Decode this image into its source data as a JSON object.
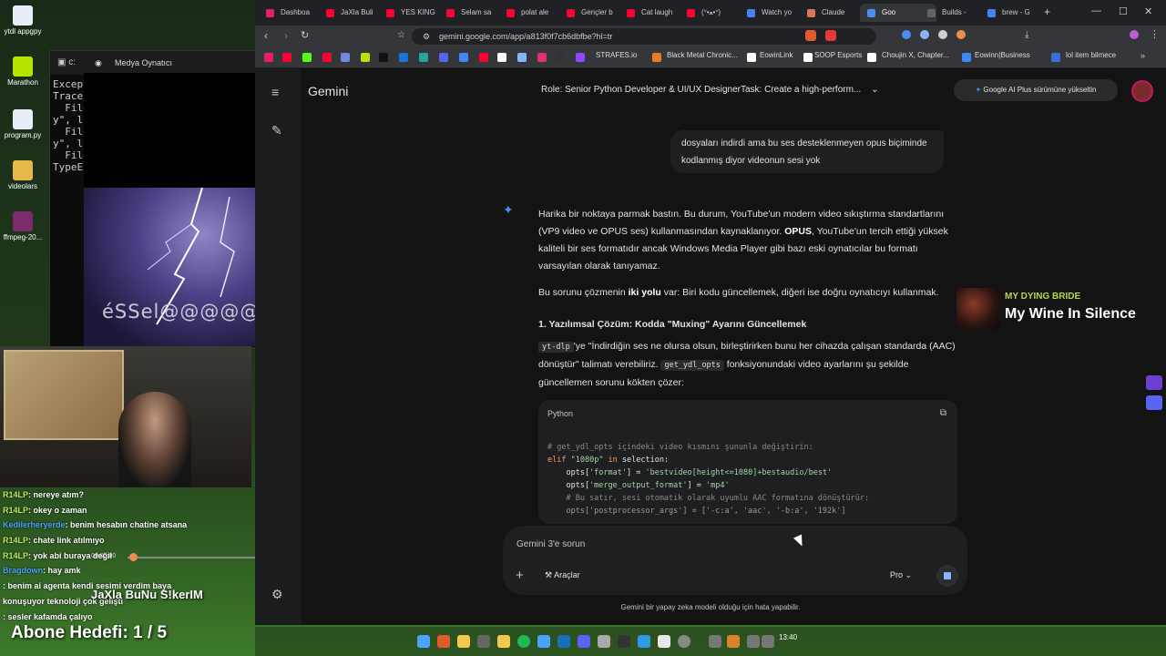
{
  "desktop": {
    "icons": [
      {
        "label": "ytdl appgpy"
      },
      {
        "label": "Marathon"
      },
      {
        "label": "program.py"
      },
      {
        "label": "videolars"
      },
      {
        "label": "ffmpeg-20..."
      }
    ]
  },
  "terminal": {
    "lines": [
      "Except",
      "Tracel",
      "  File",
      "y\", l",
      "",
      "  File",
      "y\", l",
      "",
      "  File",
      "",
      "TypeE"
    ]
  },
  "media_player": {
    "title": "Medya Oynatıcı",
    "caption": "éSSel@@@@@",
    "time": "00:00:00"
  },
  "stream": {
    "name": "JaXla BuNu S!kerIM",
    "abone": "Abone Hedefi:  1 / 5",
    "chat": [
      {
        "nick": "R14LP",
        "text": ": nereye atım?"
      },
      {
        "nick": "R14LP",
        "text": ": okey o zaman"
      },
      {
        "nick": "Kedilerheryerde",
        "text": ": benim hesabın chatine atsana"
      },
      {
        "nick": "R14LP",
        "text": ": chate link atılmıyo"
      },
      {
        "nick": "R14LP",
        "text": ": yok abi buraya değil"
      },
      {
        "nick": "Bragdown",
        "text": ": hay amk"
      },
      {
        "nick": "",
        "text": ": benim ai agenta kendi sesimi verdim baya"
      },
      {
        "nick": "",
        "text": "konuşuyor teknoloji çok gelişti"
      },
      {
        "nick": "",
        "text": ": sesler kafamda çalıyo"
      }
    ]
  },
  "browser": {
    "tabs": [
      "Dashboa",
      "JaXla Buli",
      "YES KING",
      "Selam sa",
      "polat ale",
      "Gençler b",
      "Cat laugh",
      "(ᐡ•ﻌ•ᐡ)",
      "Watch yo",
      "Claude",
      "Goo",
      "Builds -",
      "brew - G"
    ],
    "url": "gemini.google.com/app/a813f0f7cb6dbfbe?hl=tr",
    "bookmarks": [
      "STRAFES.io",
      "Black Metal Chronic...",
      "EowinLink",
      "SOOP Esports",
      "Choujin X, Chapter...",
      "Eowinn|Business",
      "lol item bilmece"
    ]
  },
  "gemini": {
    "title": "Gemini",
    "chat_title": "Role: Senior Python Developer & UI/UX DesignerTask: Create a high-perform...",
    "upgrade": "Google AI Plus sürümüne yükseltin",
    "user_msg": "dosyaları indirdi ama bu ses desteklenmeyen opus biçiminde kodlanmış diyor videonun sesi yok",
    "resp_p1_a": "Harika bir noktaya parmak bastın. Bu durum, YouTube'un modern video sıkıştırma standartlarını (VP9 video ve OPUS ses) kullanmasından kaynaklanıyor. ",
    "resp_p1_b": "OPUS",
    "resp_p1_c": ", YouTube'un tercih ettiği yüksek kaliteli bir ses formatıdır ancak Windows Media Player gibi bazı eski oynatıcılar bu formatı varsayılan olarak tanıyamaz.",
    "resp_p2_a": "Bu sorunu çözmenin ",
    "resp_p2_b": "iki yolu",
    "resp_p2_c": " var: Biri kodu güncellemek, diğeri ise doğru oynatıcıyı kullanmak.",
    "resp_h": "1. Yazılımsal Çözüm: Kodda \"Muxing\" Ayarını Güncellemek",
    "resp_p3_code1": "yt-dlp",
    "resp_p3_a": "'ye \"İndirdiğin ses ne olursa olsun, birleştirirken bunu her cihazda çalışan standarda (AAC) dönüştür\" talimatı verebiliriz. ",
    "resp_p3_code2": "get_ydl_opts",
    "resp_p3_b": " fonksiyonundaki video ayarlarını şu şekilde güncellemen sorunu kökten çözer:",
    "code_lang": "Python",
    "code": {
      "l1": "# get_ydl_opts içindeki video kısmını şununla değiştirin:",
      "l2_kw": "elif",
      "l2_str": "\"1080p\"",
      "l2_rest": " selection:",
      "l2_in": " in",
      "l3_a": "    opts[",
      "l3_k": "'format'",
      "l3_b": "] = ",
      "l3_v": "'bestvideo[height<=1080]+bestaudio/best'",
      "l4_k": "'merge_output_format'",
      "l4_v": "'mp4'",
      "l5": "    # Bu satır, sesi otomatik olarak uyumlu AAC formatına dönüştürür:",
      "l6": "    opts['postprocessor_args'] = ['-c:a', 'aac', '-b:a', '192k']"
    },
    "input_placeholder": "Gemini 3'e sorun",
    "tools": "Araçlar",
    "model": "Pro",
    "disclaimer": "Gemini bir yapay zeka modeli olduğu için hata yapabilir."
  },
  "now_playing": {
    "artist": "MY DYING BRIDE",
    "track": "My Wine In Silence"
  },
  "taskbar": {
    "time": "13:40"
  }
}
